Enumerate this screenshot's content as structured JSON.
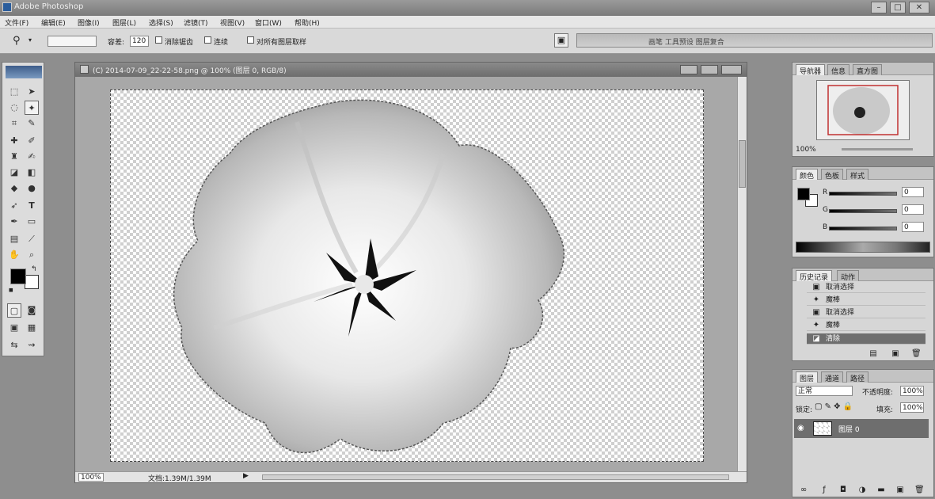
{
  "window": {
    "title": "Adobe Photoshop",
    "min_symbol": "–",
    "max_symbol": "□",
    "close_symbol": "✕"
  },
  "menubar": {
    "items": [
      "文件(F)",
      "编辑(E)",
      "图像(I)",
      "图层(L)",
      "选择(S)",
      "滤镜(T)",
      "视图(V)",
      "窗口(W)",
      "帮助(H)"
    ]
  },
  "options_bar": {
    "tolerance_label": "容差:",
    "tolerance_value": "120",
    "antialias_label": "消除锯齿",
    "contiguous_label": "连续",
    "all_layers_label": "对所有图层取样",
    "palette_well_label": "画笔 工具预设 图层复合"
  },
  "document": {
    "title": "(C) 2014-07-09_22-22-58.png @ 100% (图层 0, RGB/8)",
    "zoom": "100%",
    "doc_size": "文档:1.39M/1.39M"
  },
  "navigator": {
    "tabs": [
      "导航器",
      "信息",
      "直方图"
    ],
    "zoom": "100%"
  },
  "color_panel": {
    "tabs": [
      "颜色",
      "色板",
      "样式"
    ],
    "channels": [
      {
        "label": "R",
        "value": "0"
      },
      {
        "label": "G",
        "value": "0"
      },
      {
        "label": "B",
        "value": "0"
      }
    ]
  },
  "history_panel": {
    "tabs": [
      "历史记录",
      "动作"
    ],
    "items": [
      {
        "label": "取消选择",
        "icon": "history-state-icon"
      },
      {
        "label": "魔棒",
        "icon": "magic-wand-icon"
      },
      {
        "label": "取消选择",
        "icon": "history-state-icon"
      },
      {
        "label": "魔棒",
        "icon": "magic-wand-icon"
      },
      {
        "label": "清除",
        "icon": "eraser-icon"
      }
    ],
    "selected_index": 4
  },
  "layers_panel": {
    "tabs": [
      "图层",
      "通道",
      "路径"
    ],
    "blend_mode": "正常",
    "opacity_label": "不透明度:",
    "opacity_value": "100%",
    "lock_label": "锁定:",
    "fill_label": "填充:",
    "fill_value": "100%",
    "layers": [
      {
        "name": "图层 0",
        "visible": true
      }
    ]
  },
  "toolbox": {
    "icons": [
      "marquee-icon",
      "move-icon",
      "lasso-icon",
      "magic-wand-icon",
      "crop-icon",
      "slice-icon",
      "healing-brush-icon",
      "brush-icon",
      "clone-stamp-icon",
      "history-brush-icon",
      "eraser-icon",
      "gradient-icon",
      "blur-icon",
      "dodge-icon",
      "path-selection-icon",
      "type-icon",
      "pen-icon",
      "shape-icon",
      "notes-icon",
      "eyedropper-icon",
      "hand-icon",
      "zoom-icon"
    ]
  }
}
